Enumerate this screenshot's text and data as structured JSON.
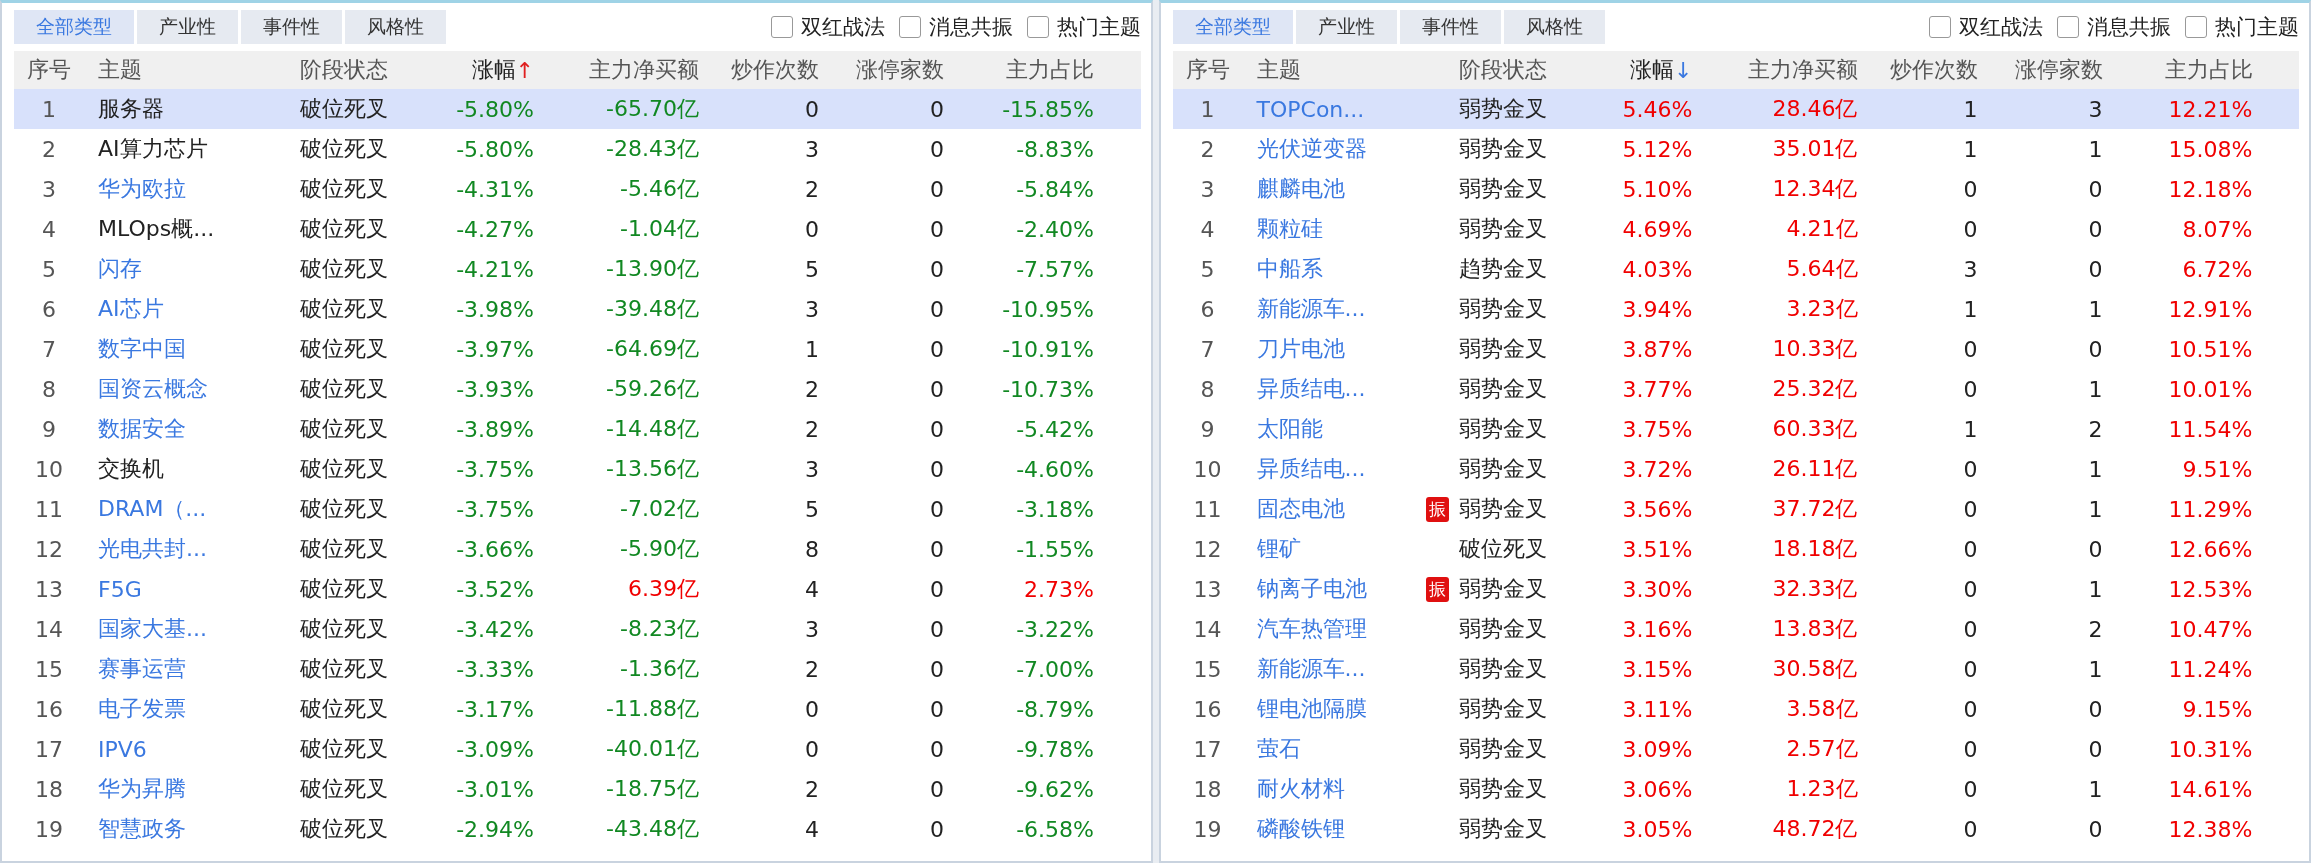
{
  "panels": [
    {
      "tabs": [
        {
          "label": "全部类型",
          "selected": true
        },
        {
          "label": "产业性",
          "selected": false
        },
        {
          "label": "事件性",
          "selected": false
        },
        {
          "label": "风格性",
          "selected": false
        }
      ],
      "filters": [
        {
          "label": "双红战法",
          "checked": false
        },
        {
          "label": "消息共振",
          "checked": false
        },
        {
          "label": "热门主题",
          "checked": false
        }
      ],
      "columns": [
        {
          "label": "序号",
          "kind": "plain"
        },
        {
          "label": "主题",
          "kind": "plain"
        },
        {
          "label": "阶段状态",
          "kind": "plain"
        },
        {
          "label": "涨幅",
          "kind": "ascending",
          "arrow": "↑"
        },
        {
          "label": "主力净买额",
          "kind": "plain"
        },
        {
          "label": "炒作次数",
          "kind": "plain"
        },
        {
          "label": "涨停家数",
          "kind": "plain"
        },
        {
          "label": "主力占比",
          "kind": "plain"
        }
      ],
      "rows": [
        {
          "index": "1",
          "theme": "服务器",
          "link": false,
          "stage": "破位死叉",
          "change": "-5.80%",
          "change_up": false,
          "net_buy": "-65.70亿",
          "flow_up": false,
          "hype_count": "0",
          "limit_up_count": "0",
          "main_ratio": "-15.85%",
          "selected": true
        },
        {
          "index": "2",
          "theme": "AI算力芯片",
          "link": false,
          "stage": "破位死叉",
          "change": "-5.80%",
          "change_up": false,
          "net_buy": "-28.43亿",
          "flow_up": false,
          "hype_count": "3",
          "limit_up_count": "0",
          "main_ratio": "-8.83%",
          "selected": false
        },
        {
          "index": "3",
          "theme": "华为欧拉",
          "link": true,
          "stage": "破位死叉",
          "change": "-4.31%",
          "change_up": false,
          "net_buy": "-5.46亿",
          "flow_up": false,
          "hype_count": "2",
          "limit_up_count": "0",
          "main_ratio": "-5.84%",
          "selected": false
        },
        {
          "index": "4",
          "theme": "MLOps概...",
          "link": false,
          "stage": "破位死叉",
          "change": "-4.27%",
          "change_up": false,
          "net_buy": "-1.04亿",
          "flow_up": false,
          "hype_count": "0",
          "limit_up_count": "0",
          "main_ratio": "-2.40%",
          "selected": false
        },
        {
          "index": "5",
          "theme": "闪存",
          "link": true,
          "stage": "破位死叉",
          "change": "-4.21%",
          "change_up": false,
          "net_buy": "-13.90亿",
          "flow_up": false,
          "hype_count": "5",
          "limit_up_count": "0",
          "main_ratio": "-7.57%",
          "selected": false
        },
        {
          "index": "6",
          "theme": "AI芯片",
          "link": true,
          "stage": "破位死叉",
          "change": "-3.98%",
          "change_up": false,
          "net_buy": "-39.48亿",
          "flow_up": false,
          "hype_count": "3",
          "limit_up_count": "0",
          "main_ratio": "-10.95%",
          "selected": false
        },
        {
          "index": "7",
          "theme": "数字中国",
          "link": true,
          "stage": "破位死叉",
          "change": "-3.97%",
          "change_up": false,
          "net_buy": "-64.69亿",
          "flow_up": false,
          "hype_count": "1",
          "limit_up_count": "0",
          "main_ratio": "-10.91%",
          "selected": false
        },
        {
          "index": "8",
          "theme": "国资云概念",
          "link": true,
          "stage": "破位死叉",
          "change": "-3.93%",
          "change_up": false,
          "net_buy": "-59.26亿",
          "flow_up": false,
          "hype_count": "2",
          "limit_up_count": "0",
          "main_ratio": "-10.73%",
          "selected": false
        },
        {
          "index": "9",
          "theme": "数据安全",
          "link": true,
          "stage": "破位死叉",
          "change": "-3.89%",
          "change_up": false,
          "net_buy": "-14.48亿",
          "flow_up": false,
          "hype_count": "2",
          "limit_up_count": "0",
          "main_ratio": "-5.42%",
          "selected": false
        },
        {
          "index": "10",
          "theme": "交换机",
          "link": false,
          "stage": "破位死叉",
          "change": "-3.75%",
          "change_up": false,
          "net_buy": "-13.56亿",
          "flow_up": false,
          "hype_count": "3",
          "limit_up_count": "0",
          "main_ratio": "-4.60%",
          "selected": false
        },
        {
          "index": "11",
          "theme": "DRAM（...",
          "link": true,
          "stage": "破位死叉",
          "change": "-3.75%",
          "change_up": false,
          "net_buy": "-7.02亿",
          "flow_up": false,
          "hype_count": "5",
          "limit_up_count": "0",
          "main_ratio": "-3.18%",
          "selected": false
        },
        {
          "index": "12",
          "theme": "光电共封...",
          "link": true,
          "stage": "破位死叉",
          "change": "-3.66%",
          "change_up": false,
          "net_buy": "-5.90亿",
          "flow_up": false,
          "hype_count": "8",
          "limit_up_count": "0",
          "main_ratio": "-1.55%",
          "selected": false
        },
        {
          "index": "13",
          "theme": "F5G",
          "link": true,
          "stage": "破位死叉",
          "change": "-3.52%",
          "change_up": false,
          "net_buy": "6.39亿",
          "flow_up": true,
          "hype_count": "4",
          "limit_up_count": "0",
          "main_ratio": "2.73%",
          "selected": false
        },
        {
          "index": "14",
          "theme": "国家大基...",
          "link": true,
          "stage": "破位死叉",
          "change": "-3.42%",
          "change_up": false,
          "net_buy": "-8.23亿",
          "flow_up": false,
          "hype_count": "3",
          "limit_up_count": "0",
          "main_ratio": "-3.22%",
          "selected": false
        },
        {
          "index": "15",
          "theme": "赛事运营",
          "link": true,
          "stage": "破位死叉",
          "change": "-3.33%",
          "change_up": false,
          "net_buy": "-1.36亿",
          "flow_up": false,
          "hype_count": "2",
          "limit_up_count": "0",
          "main_ratio": "-7.00%",
          "selected": false
        },
        {
          "index": "16",
          "theme": "电子发票",
          "link": true,
          "stage": "破位死叉",
          "change": "-3.17%",
          "change_up": false,
          "net_buy": "-11.88亿",
          "flow_up": false,
          "hype_count": "0",
          "limit_up_count": "0",
          "main_ratio": "-8.79%",
          "selected": false
        },
        {
          "index": "17",
          "theme": "IPV6",
          "link": true,
          "stage": "破位死叉",
          "change": "-3.09%",
          "change_up": false,
          "net_buy": "-40.01亿",
          "flow_up": false,
          "hype_count": "0",
          "limit_up_count": "0",
          "main_ratio": "-9.78%",
          "selected": false
        },
        {
          "index": "18",
          "theme": "华为昇腾",
          "link": true,
          "stage": "破位死叉",
          "change": "-3.01%",
          "change_up": false,
          "net_buy": "-18.75亿",
          "flow_up": false,
          "hype_count": "2",
          "limit_up_count": "0",
          "main_ratio": "-9.62%",
          "selected": false
        },
        {
          "index": "19",
          "theme": "智慧政务",
          "link": true,
          "stage": "破位死叉",
          "change": "-2.94%",
          "change_up": false,
          "net_buy": "-43.48亿",
          "flow_up": false,
          "hype_count": "4",
          "limit_up_count": "0",
          "main_ratio": "-6.58%",
          "selected": false
        }
      ]
    },
    {
      "tabs": [
        {
          "label": "全部类型",
          "selected": true
        },
        {
          "label": "产业性",
          "selected": false
        },
        {
          "label": "事件性",
          "selected": false
        },
        {
          "label": "风格性",
          "selected": false
        }
      ],
      "filters": [
        {
          "label": "双红战法",
          "checked": false
        },
        {
          "label": "消息共振",
          "checked": false
        },
        {
          "label": "热门主题",
          "checked": false
        }
      ],
      "columns": [
        {
          "label": "序号",
          "kind": "plain"
        },
        {
          "label": "主题",
          "kind": "plain"
        },
        {
          "label": "阶段状态",
          "kind": "plain"
        },
        {
          "label": "涨幅",
          "kind": "descending",
          "arrow": "↓"
        },
        {
          "label": "主力净买额",
          "kind": "plain"
        },
        {
          "label": "炒作次数",
          "kind": "plain"
        },
        {
          "label": "涨停家数",
          "kind": "plain"
        },
        {
          "label": "主力占比",
          "kind": "plain"
        }
      ],
      "rows": [
        {
          "index": "1",
          "theme": "TOPCon...",
          "link": true,
          "stage": "弱势金叉",
          "change": "5.46%",
          "change_up": true,
          "net_buy": "28.46亿",
          "flow_up": true,
          "hype_count": "1",
          "limit_up_count": "3",
          "main_ratio": "12.21%",
          "selected": true
        },
        {
          "index": "2",
          "theme": "光伏逆变器",
          "link": true,
          "stage": "弱势金叉",
          "change": "5.12%",
          "change_up": true,
          "net_buy": "35.01亿",
          "flow_up": true,
          "hype_count": "1",
          "limit_up_count": "1",
          "main_ratio": "15.08%",
          "selected": false
        },
        {
          "index": "3",
          "theme": "麒麟电池",
          "link": true,
          "stage": "弱势金叉",
          "change": "5.10%",
          "change_up": true,
          "net_buy": "12.34亿",
          "flow_up": true,
          "hype_count": "0",
          "limit_up_count": "0",
          "main_ratio": "12.18%",
          "selected": false
        },
        {
          "index": "4",
          "theme": "颗粒硅",
          "link": true,
          "stage": "弱势金叉",
          "change": "4.69%",
          "change_up": true,
          "net_buy": "4.21亿",
          "flow_up": true,
          "hype_count": "0",
          "limit_up_count": "0",
          "main_ratio": "8.07%",
          "selected": false
        },
        {
          "index": "5",
          "theme": "中船系",
          "link": true,
          "stage": "趋势金叉",
          "change": "4.03%",
          "change_up": true,
          "net_buy": "5.64亿",
          "flow_up": true,
          "hype_count": "3",
          "limit_up_count": "0",
          "main_ratio": "6.72%",
          "selected": false
        },
        {
          "index": "6",
          "theme": "新能源车...",
          "link": true,
          "stage": "弱势金叉",
          "change": "3.94%",
          "change_up": true,
          "net_buy": "3.23亿",
          "flow_up": true,
          "hype_count": "1",
          "limit_up_count": "1",
          "main_ratio": "12.91%",
          "selected": false
        },
        {
          "index": "7",
          "theme": "刀片电池",
          "link": true,
          "stage": "弱势金叉",
          "change": "3.87%",
          "change_up": true,
          "net_buy": "10.33亿",
          "flow_up": true,
          "hype_count": "0",
          "limit_up_count": "0",
          "main_ratio": "10.51%",
          "selected": false
        },
        {
          "index": "8",
          "theme": "异质结电...",
          "link": true,
          "stage": "弱势金叉",
          "change": "3.77%",
          "change_up": true,
          "net_buy": "25.32亿",
          "flow_up": true,
          "hype_count": "0",
          "limit_up_count": "1",
          "main_ratio": "10.01%",
          "selected": false
        },
        {
          "index": "9",
          "theme": "太阳能",
          "link": true,
          "stage": "弱势金叉",
          "change": "3.75%",
          "change_up": true,
          "net_buy": "60.33亿",
          "flow_up": true,
          "hype_count": "1",
          "limit_up_count": "2",
          "main_ratio": "11.54%",
          "selected": false
        },
        {
          "index": "10",
          "theme": "异质结电...",
          "link": true,
          "stage": "弱势金叉",
          "change": "3.72%",
          "change_up": true,
          "net_buy": "26.11亿",
          "flow_up": true,
          "hype_count": "0",
          "limit_up_count": "1",
          "main_ratio": "9.51%",
          "selected": false
        },
        {
          "index": "11",
          "theme": "固态电池",
          "link": true,
          "badge": "振",
          "stage": "弱势金叉",
          "change": "3.56%",
          "change_up": true,
          "net_buy": "37.72亿",
          "flow_up": true,
          "hype_count": "0",
          "limit_up_count": "1",
          "main_ratio": "11.29%",
          "selected": false
        },
        {
          "index": "12",
          "theme": "锂矿",
          "link": true,
          "stage": "破位死叉",
          "change": "3.51%",
          "change_up": true,
          "net_buy": "18.18亿",
          "flow_up": true,
          "hype_count": "0",
          "limit_up_count": "0",
          "main_ratio": "12.66%",
          "selected": false
        },
        {
          "index": "13",
          "theme": "钠离子电池",
          "link": true,
          "badge": "振",
          "stage": "弱势金叉",
          "change": "3.30%",
          "change_up": true,
          "net_buy": "32.33亿",
          "flow_up": true,
          "hype_count": "0",
          "limit_up_count": "1",
          "main_ratio": "12.53%",
          "selected": false
        },
        {
          "index": "14",
          "theme": "汽车热管理",
          "link": true,
          "stage": "弱势金叉",
          "change": "3.16%",
          "change_up": true,
          "net_buy": "13.83亿",
          "flow_up": true,
          "hype_count": "0",
          "limit_up_count": "2",
          "main_ratio": "10.47%",
          "selected": false
        },
        {
          "index": "15",
          "theme": "新能源车...",
          "link": true,
          "stage": "弱势金叉",
          "change": "3.15%",
          "change_up": true,
          "net_buy": "30.58亿",
          "flow_up": true,
          "hype_count": "0",
          "limit_up_count": "1",
          "main_ratio": "11.24%",
          "selected": false
        },
        {
          "index": "16",
          "theme": "锂电池隔膜",
          "link": true,
          "stage": "弱势金叉",
          "change": "3.11%",
          "change_up": true,
          "net_buy": "3.58亿",
          "flow_up": true,
          "hype_count": "0",
          "limit_up_count": "0",
          "main_ratio": "9.15%",
          "selected": false
        },
        {
          "index": "17",
          "theme": "萤石",
          "link": true,
          "stage": "弱势金叉",
          "change": "3.09%",
          "change_up": true,
          "net_buy": "2.57亿",
          "flow_up": true,
          "hype_count": "0",
          "limit_up_count": "0",
          "main_ratio": "10.31%",
          "selected": false
        },
        {
          "index": "18",
          "theme": "耐火材料",
          "link": true,
          "stage": "弱势金叉",
          "change": "3.06%",
          "change_up": true,
          "net_buy": "1.23亿",
          "flow_up": true,
          "hype_count": "0",
          "limit_up_count": "1",
          "main_ratio": "14.61%",
          "selected": false
        },
        {
          "index": "19",
          "theme": "磷酸铁锂",
          "link": true,
          "stage": "弱势金叉",
          "change": "3.05%",
          "change_up": true,
          "net_buy": "48.72亿",
          "flow_up": true,
          "hype_count": "0",
          "limit_up_count": "0",
          "main_ratio": "12.38%",
          "selected": false
        }
      ]
    }
  ]
}
